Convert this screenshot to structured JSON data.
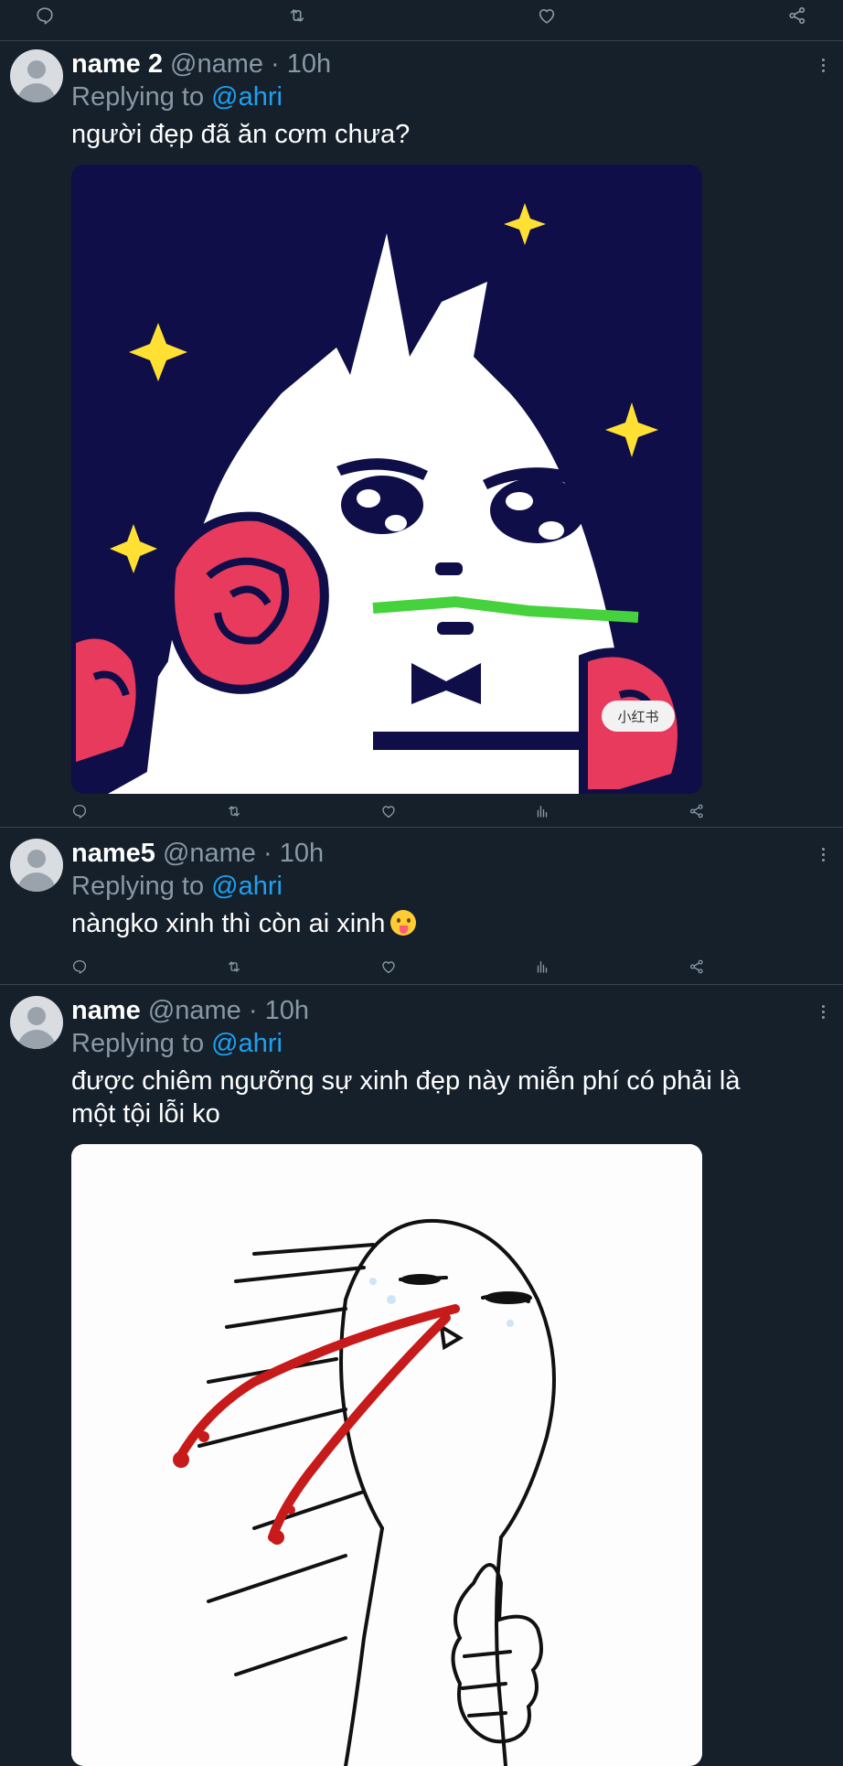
{
  "top_actions": {
    "icons": [
      "reply-icon",
      "retweet-icon",
      "like-icon",
      "share-icon"
    ]
  },
  "tweets": [
    {
      "name": "name 2",
      "meta": "@name · 10h",
      "replying_prefix": "Replying to",
      "replying_to": "@ahri",
      "text": "người đẹp đã ăn cơm chưa?",
      "media": "pixel-art cat holding rose image",
      "watermark": "小红书",
      "actions": [
        "reply-icon",
        "retweet-icon",
        "like-icon",
        "analytics-icon",
        "share-icon"
      ]
    },
    {
      "name": "name5",
      "meta": "@name · 10h",
      "replying_prefix": "Replying to",
      "replying_to": "@ahri",
      "text": "nàngko xinh thì còn ai xinh",
      "emoji": "tongue-out-emoji",
      "actions": [
        "reply-icon",
        "retweet-icon",
        "like-icon",
        "analytics-icon",
        "share-icon"
      ]
    },
    {
      "name": "name",
      "meta": "@name · 10h",
      "replying_prefix": "Replying to",
      "replying_to": "@ahri",
      "text_line1": "được chiêm ngưỡng sự xinh đẹp này miễn phí có phải là",
      "text_line2": "một tội lỗi ko",
      "media": "meme nosebleed thumbs-up image"
    }
  ],
  "colors": {
    "background": "#15202b",
    "divider": "#38444d",
    "secondary_text": "#8899a6",
    "mention": "#1da1f2"
  }
}
